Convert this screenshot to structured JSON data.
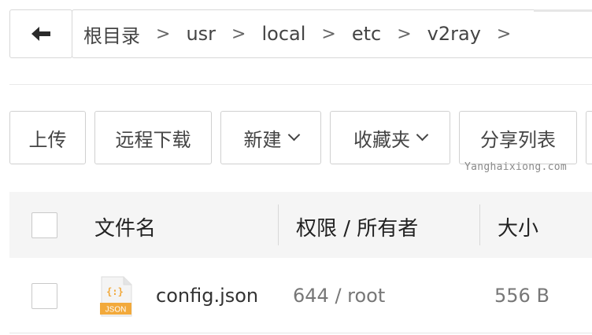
{
  "navigation": {
    "back_icon": "arrow-left-icon",
    "breadcrumb": [
      "根目录",
      "usr",
      "local",
      "etc",
      "v2ray"
    ],
    "separator": ">"
  },
  "toolbar": {
    "upload": "上传",
    "remote_download": "远程下载",
    "new": "新建",
    "favorites": "收藏夹",
    "share_list": "分享列表",
    "dropdown_icon": "chevron-down-icon"
  },
  "watermark": "Yanghaixiong.com",
  "table": {
    "columns": [
      "文件名",
      "权限 / 所有者",
      "大小"
    ],
    "rows": [
      {
        "name": "config.json",
        "permission": "644 / root",
        "size": "556 B",
        "icon": "json-file-icon",
        "icon_glyph": "{:}",
        "icon_badge": "JSON"
      }
    ]
  },
  "colors": {
    "border": "#d0d0d0",
    "header_bg": "#f5f5f5",
    "json_icon_accent": "#f2a93b",
    "muted_text": "#777777"
  }
}
